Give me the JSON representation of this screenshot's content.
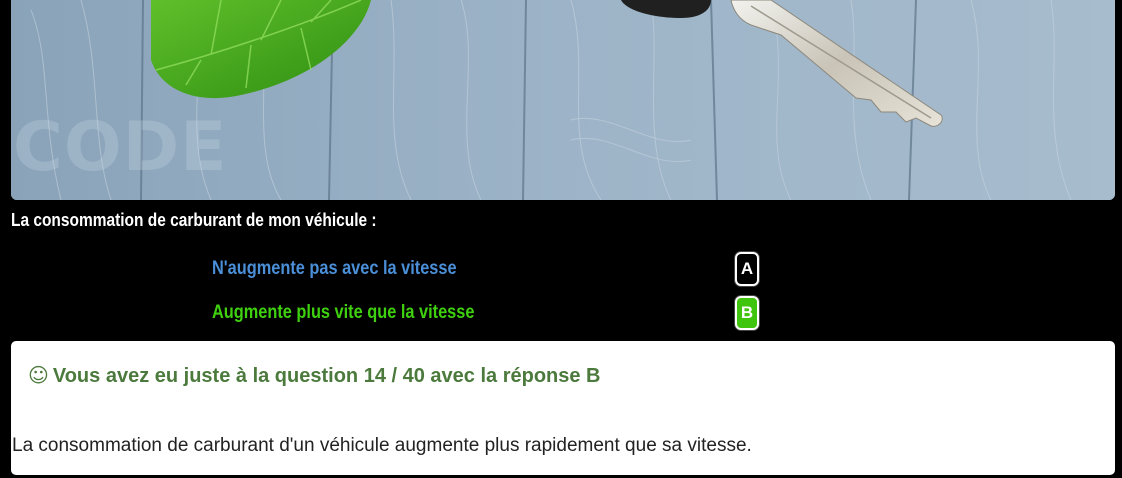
{
  "photo": {
    "watermark": "CODE",
    "watermark_sub": "··········"
  },
  "question": {
    "text": "La consommation de carburant de mon véhicule :"
  },
  "answers": [
    {
      "label": "N'augmente pas avec la vitesse",
      "key": "A",
      "color": "#4a8fd8",
      "selected": false
    },
    {
      "label": "Augmente plus vite que la vitesse",
      "key": "B",
      "color": "#3fd10f",
      "selected": true
    }
  ],
  "result": {
    "icon": "smiley-icon",
    "icon_glyph": "☺",
    "title": "Vous avez eu juste à la question 14 / 40 avec la réponse B",
    "explanation": "La consommation de carburant d'un véhicule augmente plus rapidement que sa vitesse.",
    "title_color": "#4b7a3c"
  },
  "colors": {
    "background": "#000000",
    "correct_green": "#3fc50d"
  }
}
